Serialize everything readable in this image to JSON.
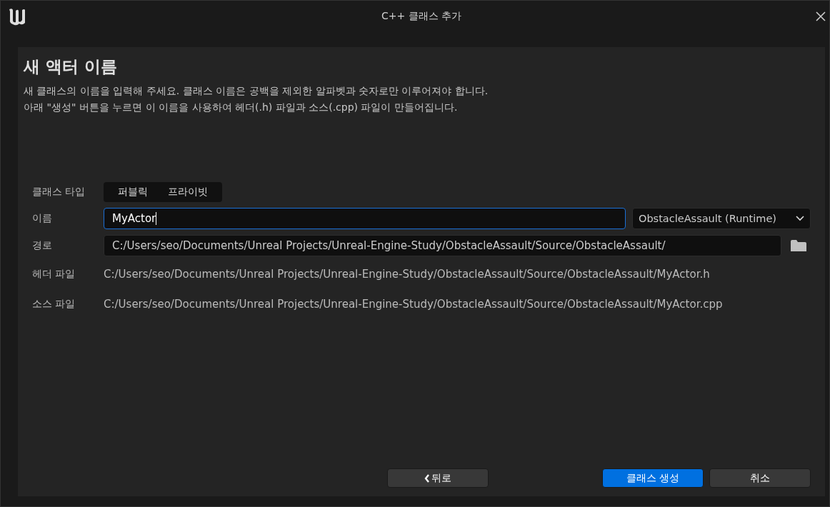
{
  "window": {
    "title": "C++ 클래스 추가"
  },
  "heading": "새 액터 이름",
  "description": [
    "새 클래스의 이름을 입력해 주세요. 클래스 이름은 공백을 제외한 알파벳과 숫자로만 이루어져야 합니다.",
    "아래 \"생성\" 버튼을 누르면 이 이름을 사용하여 헤더(.h) 파일과 소스(.cpp) 파일이 만들어집니다."
  ],
  "class_type": {
    "label": "클래스 타입",
    "options": [
      {
        "label": "퍼블릭",
        "selected": false
      },
      {
        "label": "프라이빗",
        "selected": false
      }
    ]
  },
  "name": {
    "label": "이름",
    "value": "MyActor",
    "focused": true,
    "module": "ObstacleAssault (Runtime)"
  },
  "path": {
    "label": "경로",
    "value": "C:/Users/seo/Documents/Unreal Projects/Unreal-Engine-Study/ObstacleAssault/Source/ObstacleAssault/"
  },
  "files": [
    {
      "label": "헤더 파일",
      "value": "C:/Users/seo/Documents/Unreal Projects/Unreal-Engine-Study/ObstacleAssault/Source/ObstacleAssault/MyActor.h"
    },
    {
      "label": "소스 파일",
      "value": "C:/Users/seo/Documents/Unreal Projects/Unreal-Engine-Study/ObstacleAssault/Source/ObstacleAssault/MyActor.cpp"
    }
  ],
  "buttons": {
    "back": "뒤로",
    "create": "클래스 생성",
    "cancel": "취소"
  }
}
